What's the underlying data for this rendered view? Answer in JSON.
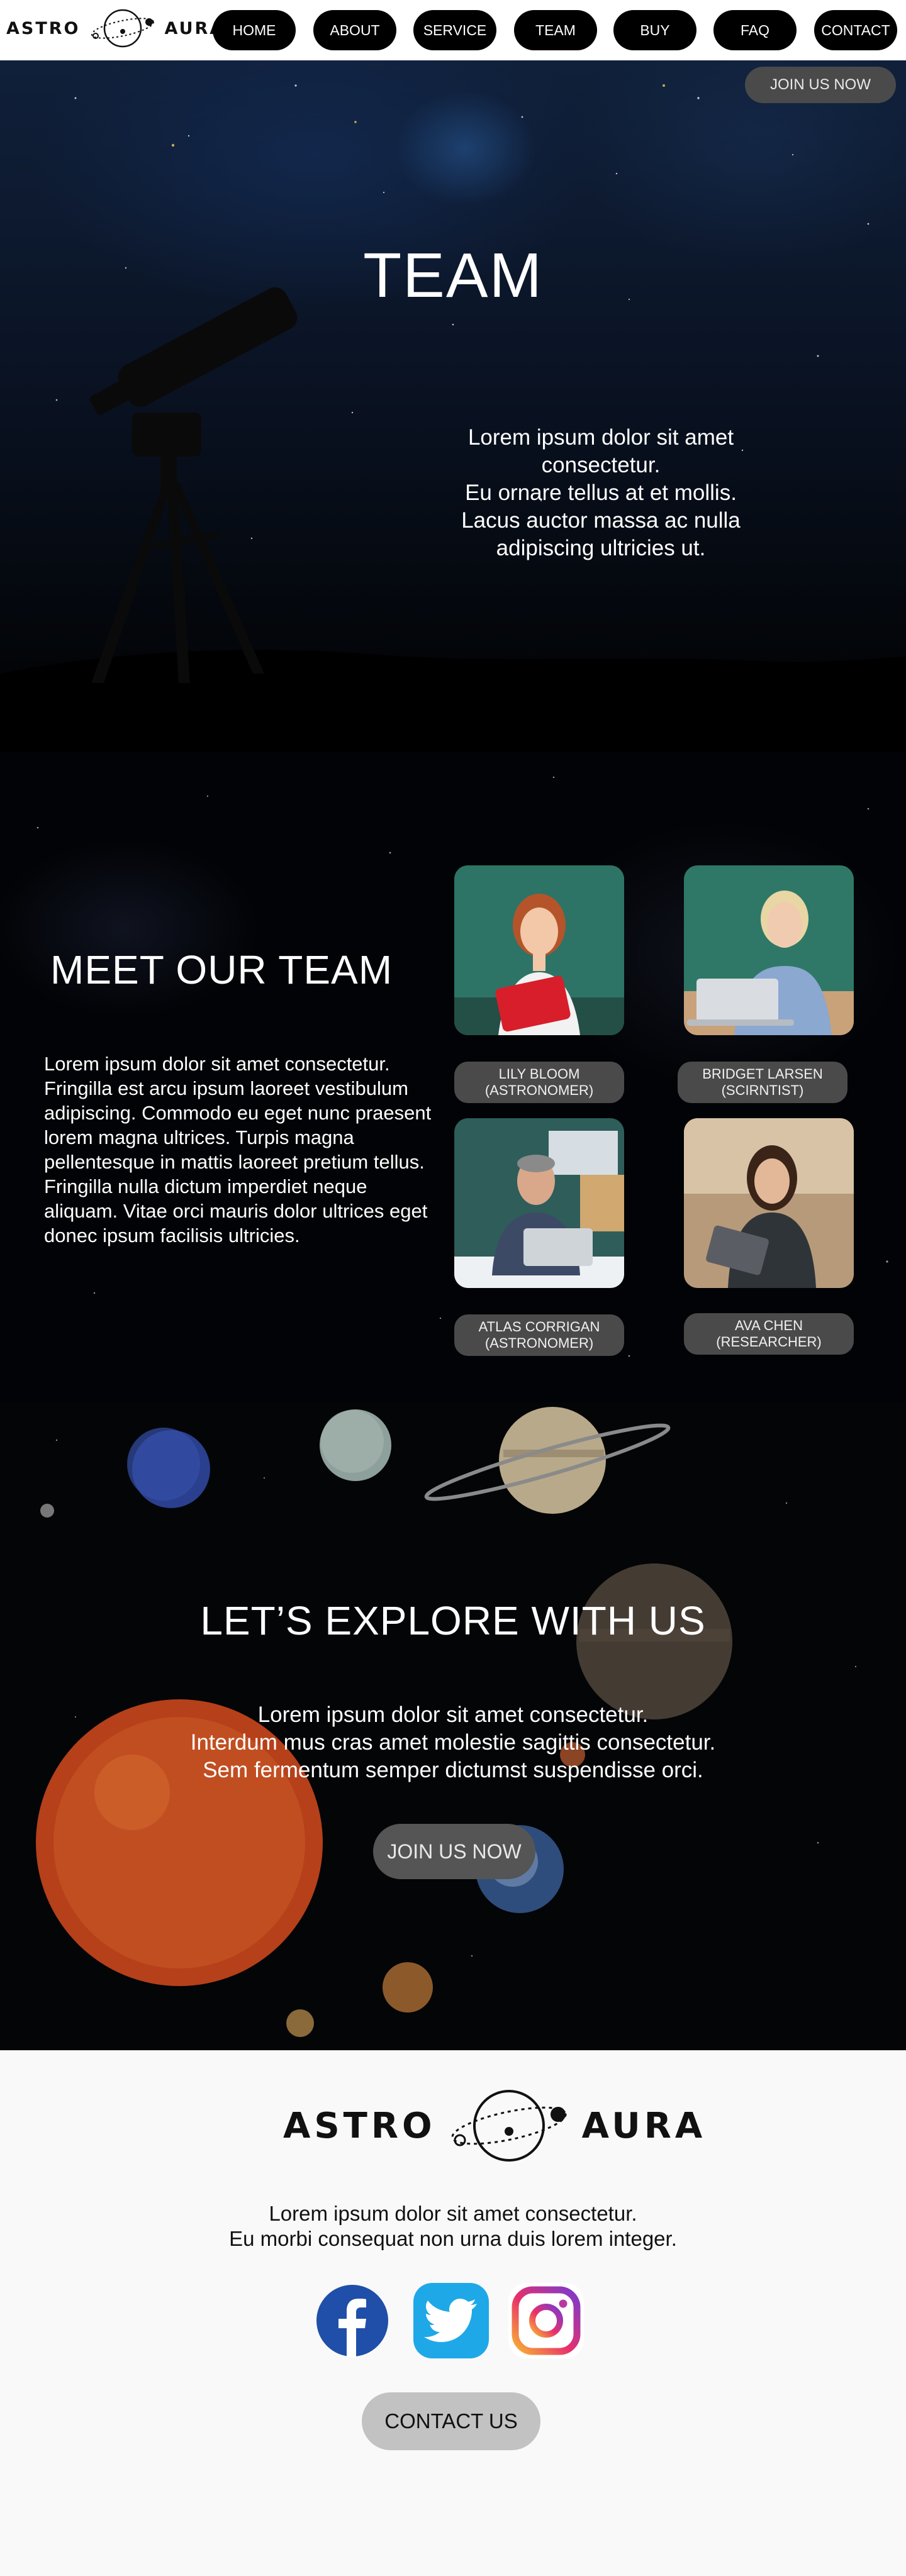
{
  "brand": {
    "word_left": "ASTRO",
    "word_right": "AURA"
  },
  "nav": {
    "items": [
      "HOME",
      "ABOUT",
      "SERVICE",
      "TEAM",
      "BUY",
      "FAQ",
      "CONTACT"
    ],
    "join_label": "JOIN US NOW"
  },
  "hero": {
    "title": "TEAM",
    "lines": [
      "Lorem ipsum dolor sit amet",
      "consectetur.",
      "Eu ornare tellus at et mollis.",
      "Lacus auctor massa ac nulla",
      "adipiscing ultricies ut."
    ]
  },
  "team": {
    "title": "MEET OUR TEAM",
    "text": "Lorem ipsum dolor sit amet consectetur. Fringilla est arcu ipsum laoreet vestibulum adipiscing. Commodo eu eget nunc praesent lorem magna ultrices. Turpis magna pellentesque in mattis laoreet pretium tellus. Fringilla nulla dictum imperdiet neque aliquam. Vitae orci mauris dolor ultrices eget donec ipsum facilisis ultricies.",
    "members": [
      {
        "name": "LILY BLOOM",
        "role": "(ASTRONOMER)"
      },
      {
        "name": "BRIDGET LARSEN",
        "role": "(SCIRNTIST)"
      },
      {
        "name": "ATLAS CORRIGAN",
        "role": "(ASTRONOMER)"
      },
      {
        "name": "AVA CHEN",
        "role": "(RESEARCHER)"
      }
    ]
  },
  "explore": {
    "title": "LET’S EXPLORE WITH US",
    "lines": [
      "Lorem ipsum dolor sit amet consectetur.",
      "Interdum mus cras amet molestie sagittis consectetur.",
      "Sem fermentum semper dictumst suspendisse orci."
    ],
    "button": "JOIN US NOW"
  },
  "footer": {
    "lines": [
      "Lorem ipsum dolor sit amet consectetur.",
      "Eu morbi consequat non urna duis lorem integer."
    ],
    "social": [
      "facebook-icon",
      "twitter-icon",
      "instagram-icon"
    ],
    "contact_button": "CONTACT US"
  },
  "colors": {
    "nav_bg": "#ffffff",
    "pill_dark": "#000000",
    "pill_gray": "#4a4a4a",
    "footer_bg": "#f9f9f9",
    "facebook": "#1f4fa8",
    "twitter": "#1da1f2"
  }
}
